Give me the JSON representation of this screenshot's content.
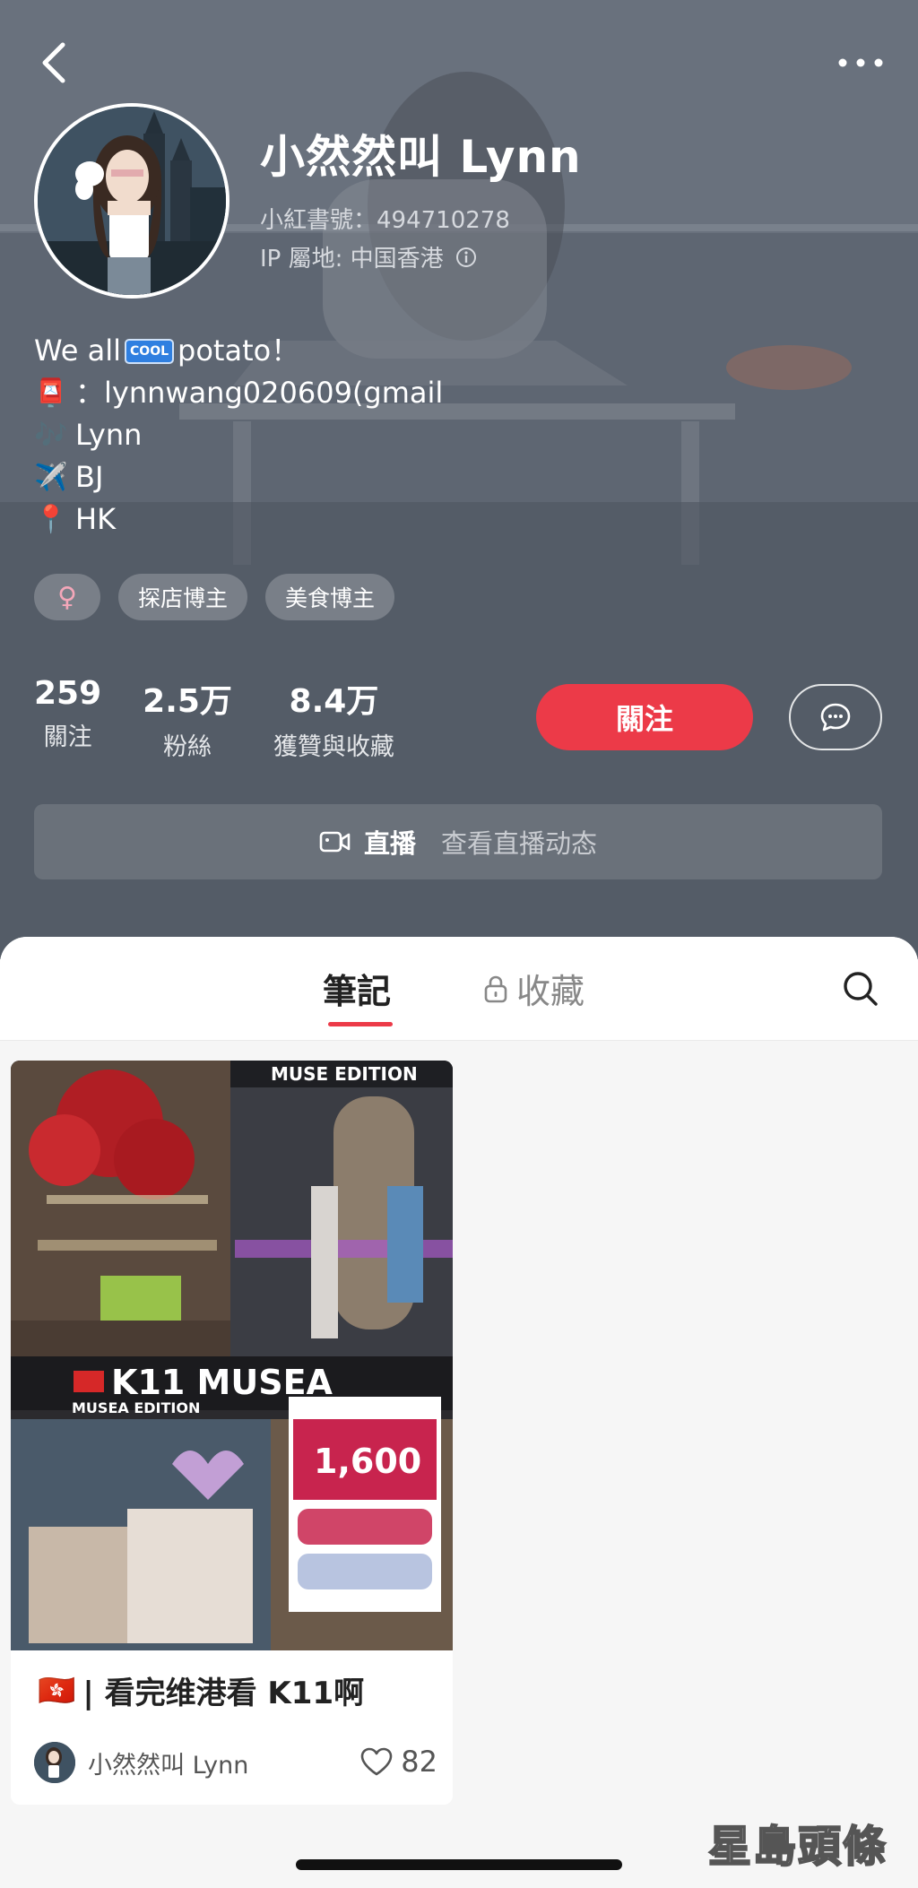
{
  "profile": {
    "nickname": "小然然叫 Lynn",
    "account_id": "小紅書號：494710278",
    "ip_location": "IP 屬地: 中国香港"
  },
  "bio": {
    "line1_prefix": "We all ",
    "line1_badge": "COOL",
    "line1_suffix": "potato！",
    "line2_emoji": "📮",
    "line2_text": "：lynnwang020609(gmail",
    "line3_emoji": "🎶",
    "line3_text": "Lynn",
    "line4_emoji": "✈️",
    "line4_text": "BJ",
    "line5_emoji": "📍",
    "line5_text": "HK"
  },
  "tags": {
    "gender": "♀",
    "tag1": "探店博主",
    "tag2": "美食博主"
  },
  "stats": {
    "following_count": "259",
    "following_label": "關注",
    "fans_count": "2.5万",
    "fans_label": "粉絲",
    "likes_count": "8.4万",
    "likes_label": "獲贊與收藏"
  },
  "actions": {
    "follow_label": "關注"
  },
  "live": {
    "title": "直播",
    "subtitle": "查看直播动态"
  },
  "tabs": {
    "notes": "筆記",
    "collections": "收藏"
  },
  "note": {
    "flag": "🇭🇰",
    "title": "| 看完维港看 K11啊",
    "author": "小然然叫 Lynn",
    "likes": "82",
    "image_text": {
      "muse_edition": "MUSE EDITION",
      "k11_musea": "K11 MUSEA",
      "musea_edition": "MUSEA EDITION",
      "amount": "1,600"
    }
  },
  "watermark": "星島頭條",
  "colors": {
    "accent": "#ec3a48",
    "header_bg": "#5a616c"
  }
}
